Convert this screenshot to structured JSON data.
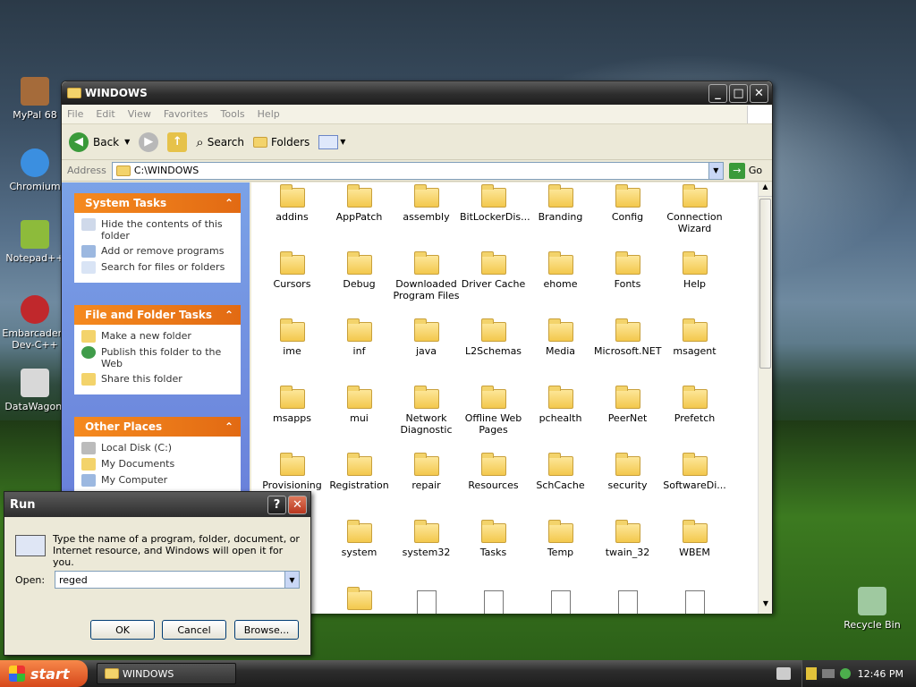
{
  "desktop_icons": [
    {
      "label": "MyPal 68",
      "color": "#a56b3a"
    },
    {
      "label": "Chromium",
      "color": "#3b8fe0"
    },
    {
      "label": "Notepad++",
      "color": "#8dbb3b"
    },
    {
      "label": "Embarcadero Dev-C++",
      "color": "#c0282c"
    },
    {
      "label": "DataWagon.",
      "color": "#d8d8d8"
    },
    {
      "label": "Recycle Bin",
      "color": "#9fc9a0"
    }
  ],
  "explorer": {
    "title": "WINDOWS",
    "menu": [
      "File",
      "Edit",
      "View",
      "Favorites",
      "Tools",
      "Help"
    ],
    "toolbar": {
      "back": "Back",
      "search": "Search",
      "folders": "Folders"
    },
    "address": {
      "label": "Address",
      "value": "C:\\WINDOWS",
      "go": "Go"
    },
    "panels": [
      {
        "title": "System Tasks",
        "items": [
          "Hide the contents of this folder",
          "Add or remove programs",
          "Search for files or folders"
        ]
      },
      {
        "title": "File and Folder Tasks",
        "items": [
          "Make a new folder",
          "Publish this folder to the Web",
          "Share this folder"
        ]
      },
      {
        "title": "Other Places",
        "items": [
          "Local Disk (C:)",
          "My Documents",
          "My Computer"
        ]
      }
    ],
    "items": [
      "addins",
      "AppPatch",
      "assembly",
      "BitLockerDis...",
      "Branding",
      "Config",
      "Connection Wizard",
      "Cursors",
      "Debug",
      "Downloaded Program Files",
      "Driver Cache",
      "ehome",
      "Fonts",
      "Help",
      "ime",
      "inf",
      "java",
      "L2Schemas",
      "Media",
      "Microsoft.NET",
      "msagent",
      "msapps",
      "mui",
      "Network Diagnostic",
      "Offline Web Pages",
      "pchealth",
      "PeerNet",
      "Prefetch",
      "Provisioning",
      "Registration",
      "repair",
      "Resources",
      "SchCache",
      "security",
      "SoftwareDi...",
      "",
      "system",
      "system32",
      "Tasks",
      "Temp",
      "twain_32",
      "WBEM"
    ]
  },
  "run_dialog": {
    "title": "Run",
    "help_btn": "?",
    "close_btn": "✕",
    "description": "Type the name of a program, folder, document, or Internet resource, and Windows will open it for you.",
    "open_label": "Open:",
    "open_value": "reged",
    "ok": "OK",
    "cancel": "Cancel",
    "browse": "Browse..."
  },
  "taskbar": {
    "start": "start",
    "task": "WINDOWS",
    "time": "12:46 PM"
  }
}
